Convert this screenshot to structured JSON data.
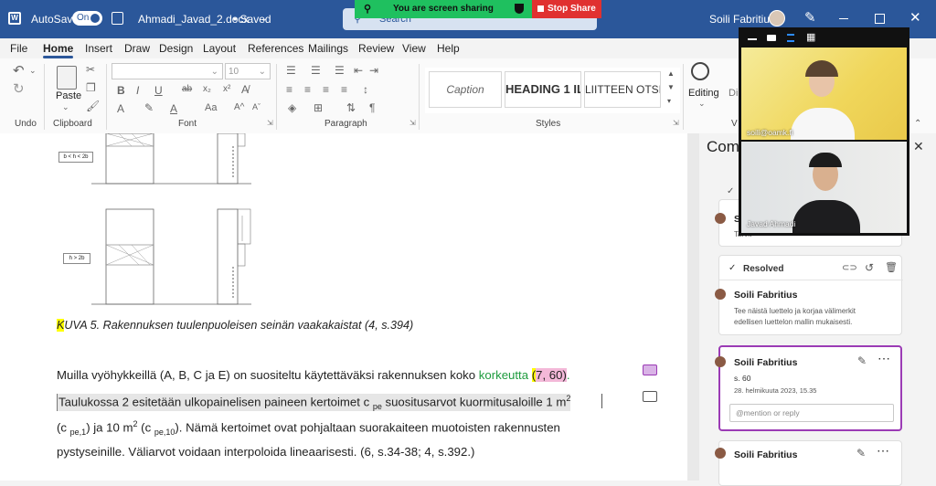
{
  "titlebar": {
    "autosave_label": "AutoSave",
    "autosave_state": "On",
    "filename": "Ahmadi_Javad_2.docx",
    "save_status": "• Saved",
    "search_placeholder": "Search",
    "user_name": "Soili Fabritius"
  },
  "screen_share": {
    "banner_text": "You are screen sharing",
    "stop_label": "Stop Share"
  },
  "menu": [
    "File",
    "Home",
    "Insert",
    "Draw",
    "Design",
    "Layout",
    "References",
    "Mailings",
    "Review",
    "View",
    "Help"
  ],
  "ribbon": {
    "undo_group": "Undo",
    "clipboard_group": "Clipboard",
    "paste_label": "Paste",
    "font_group": "Font",
    "font_size": "10",
    "paragraph_group": "Paragraph",
    "styles_group": "Styles",
    "styles": [
      "Caption",
      "HEADING 1 IL",
      "LIITTEEN OTSIK"
    ],
    "editing_label": "Editing",
    "dictate_label": "Di",
    "voice_group": "V"
  },
  "document": {
    "figure_labels": [
      "b < h < 2b",
      "h > 2b"
    ],
    "caption_k": "K",
    "caption_rest": "UVA 5. Rakennuksen tuulenpuoleisen seinän vaakakaistat (4, s.394)",
    "para1_pre": "Muilla vyöhykkeillä (A, B, C ja E) on suositeltu käytettäväksi rakennuksen koko ",
    "para1_green": "korkeutta",
    "para1_sel_open": "(",
    "para1_hl": "7, 60",
    "para1_sel_close": ")",
    "para1_end": ".",
    "para2": "Taulukossa 2 esitetään ulkopainelisen paineen kertoimet c ",
    "para2_sub": "pe",
    "para2_rest": " suositusarvot kuormitusaloille 1 m",
    "para2_sup": "2",
    "para3_a": "(c ",
    "para3_sub1": "pe,1",
    "para3_b": ") ja 10 m",
    "para3_sup": "2",
    "para3_c": " (c ",
    "para3_sub2": "pe,10",
    "para3_d": "). Nämä kertoimet ovat pohjaltaan suorakaiteen muotoisten rakennusten",
    "para4": "pystyseinille. Väliarvot voidaan interpoloida lineaarisesti. (6, s.34-38; 4, s.392.)"
  },
  "comments_pane": {
    "title": "Comments",
    "card1_name": "Soili",
    "card1_text": "Tarvit",
    "resolved_label": "Resolved",
    "card2_name": "Soili Fabritius",
    "card2_text_line1": "Tee näistä luettelo ja korjaa välimerkit",
    "card2_text_line2": "edellisen luettelon mallin mukaisesti.",
    "card3_name": "Soili Fabritius",
    "card3_text": "s. 60",
    "card3_date": "28. helmikuuta 2023, 15.35",
    "card3_reply_placeholder": "@mention or reply",
    "card4_name": "Soili Fabritius"
  },
  "video": {
    "participant1_label": "soili@oamk.fi",
    "participant2_label": "Javad Ahmadi"
  },
  "colors": {
    "word_blue": "#2b579a",
    "share_green": "#1fc05f",
    "share_red": "#e03130",
    "highlight_yellow": "#ffff00",
    "highlight_pink": "#f3b8d8",
    "comment_purple": "#9b3bb5",
    "tracked_green": "#1e9b3e"
  }
}
